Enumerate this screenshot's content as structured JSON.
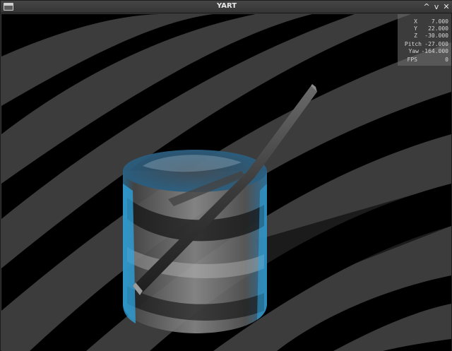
{
  "window": {
    "title": "YART",
    "controls": {
      "maximize": "^",
      "minimize": "v",
      "close": "✕"
    }
  },
  "hud": {
    "x": {
      "label": "X",
      "value": "7.000"
    },
    "y": {
      "label": "Y",
      "value": "22.000"
    },
    "z": {
      "label": "Z",
      "value": "-30.000"
    },
    "pitch": {
      "label": "Pitch",
      "value": "-27.000"
    },
    "yaw": {
      "label": "Yaw",
      "value": "-164.000"
    },
    "fps": {
      "label": "FPS",
      "value": "0"
    }
  },
  "colors": {
    "stripe_dark": "#000000",
    "stripe_light": "#3c3c3c",
    "glass_edge": "#2fa6e0",
    "straw": "#3a3a3a"
  }
}
